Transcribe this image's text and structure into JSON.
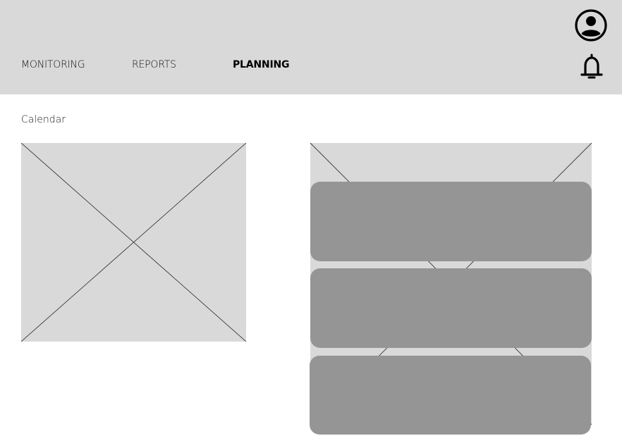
{
  "nav": {
    "tabs": [
      {
        "label": "MONITORING",
        "active": false
      },
      {
        "label": "REPORTS",
        "active": false
      },
      {
        "label": "PLANNING",
        "active": true
      }
    ]
  },
  "header": {
    "icons": [
      "user-profile-icon",
      "notification-bell-icon"
    ]
  },
  "calendar": {
    "label": "Calendar",
    "placeholder": "image-placeholder"
  },
  "planning_list": {
    "placeholder": "image-placeholder",
    "cards": [
      {
        "id": "plan-card-1"
      },
      {
        "id": "plan-card-2"
      },
      {
        "id": "plan-card-3"
      }
    ]
  },
  "colors": {
    "header_bg": "#d9d9d9",
    "placeholder_bg": "#d9d9d9",
    "card_bg": "#959595"
  }
}
